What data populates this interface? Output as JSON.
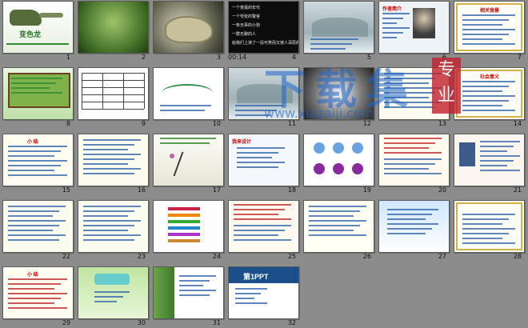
{
  "slides": [
    {
      "num": "1",
      "theme": "chameleon-title",
      "title": "变色龙"
    },
    {
      "num": "2",
      "theme": "green-leaf"
    },
    {
      "num": "3",
      "theme": "chameleon-photo"
    },
    {
      "num": "4",
      "theme": "dark-text",
      "time": "00:14",
      "lines": [
        "一个荒诞的年代",
        "一个夸张的警官",
        "一条无辜的小狗",
        "一群无聊的人",
        "给我们上演了一段可笑而又使人深思的故事"
      ]
    },
    {
      "num": "5",
      "theme": "winter-scene"
    },
    {
      "num": "6",
      "theme": "author-portrait",
      "title": "作者简介"
    },
    {
      "num": "7",
      "theme": "text-border",
      "title": "相关背景"
    },
    {
      "num": "8",
      "theme": "wood-sign"
    },
    {
      "num": "9",
      "theme": "table"
    },
    {
      "num": "10",
      "theme": "mountain-diagram"
    },
    {
      "num": "11",
      "theme": "winter-scene"
    },
    {
      "num": "12",
      "theme": "snow-flower"
    },
    {
      "num": "13",
      "theme": "text-lines"
    },
    {
      "num": "14",
      "theme": "text-border",
      "title": "社会意义"
    },
    {
      "num": "15",
      "theme": "summary",
      "title": "小 结"
    },
    {
      "num": "16",
      "theme": "text-lines"
    },
    {
      "num": "17",
      "theme": "ink-plant"
    },
    {
      "num": "18",
      "theme": "diagram-blue",
      "title": "我来设计"
    },
    {
      "num": "19",
      "theme": "faces-diagram"
    },
    {
      "num": "20",
      "theme": "text-red"
    },
    {
      "num": "21",
      "theme": "costume"
    },
    {
      "num": "22",
      "theme": "text-lines"
    },
    {
      "num": "23",
      "theme": "text-lines"
    },
    {
      "num": "24",
      "theme": "ribbon-list"
    },
    {
      "num": "25",
      "theme": "text-red"
    },
    {
      "num": "26",
      "theme": "text-blue"
    },
    {
      "num": "27",
      "theme": "gradient-blue"
    },
    {
      "num": "28",
      "theme": "text-border"
    },
    {
      "num": "29",
      "theme": "summary-red",
      "title": "小 结"
    },
    {
      "num": "30",
      "theme": "green-field"
    },
    {
      "num": "31",
      "theme": "tree-frame"
    },
    {
      "num": "32",
      "theme": "ppt-logo",
      "title": "第1PPT"
    }
  ],
  "watermark": {
    "text": "下载集",
    "seal": "专业",
    "url": "www.xiazaiji.com"
  },
  "colors": {
    "background": "#8c8c8c",
    "watermark": "#1e64c8",
    "seal": "#c2202c"
  }
}
